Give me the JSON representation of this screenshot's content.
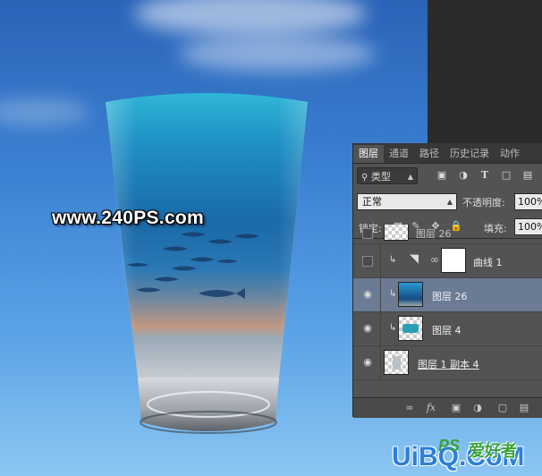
{
  "artwork": {
    "watermark": "www.240PS.com",
    "logo_main": "UiBQ.CoM",
    "logo_sub": "PS",
    "logo_badge": "爱好者"
  },
  "layers_panel": {
    "tabs": [
      {
        "label": "图层",
        "active": true
      },
      {
        "label": "通道",
        "active": false
      },
      {
        "label": "路径",
        "active": false
      },
      {
        "label": "历史记录",
        "active": false
      },
      {
        "label": "动作",
        "active": false
      }
    ],
    "filter_label": "类型",
    "blend_mode": "正常",
    "opacity_label": "不透明度:",
    "opacity_value": "100%",
    "lock_label": "锁定:",
    "fill_label": "填充:",
    "fill_value": "100%",
    "layers": [
      {
        "name": "图层 26",
        "visible": false,
        "clipped": false,
        "partial": true
      },
      {
        "name": "曲线 1",
        "visible": false,
        "clipped": true,
        "type": "adjustment"
      },
      {
        "name": "图层 26",
        "visible": true,
        "clipped": true,
        "selected": true
      },
      {
        "name": "图层 4",
        "visible": true,
        "clipped": true
      },
      {
        "name": "图层 1 副本 4",
        "visible": true,
        "clipped": false
      }
    ],
    "bottom_icons": [
      "link-icon",
      "fx-icon",
      "mask-icon",
      "adjustment-icon",
      "group-icon",
      "new-layer-icon"
    ],
    "bottom_fx_label": "fx"
  },
  "colors": {
    "panel_bg": "#535353",
    "selected_layer": "#6b7b94",
    "sky_top": "#2a63b8",
    "sky_bottom": "#8cc6f2"
  }
}
